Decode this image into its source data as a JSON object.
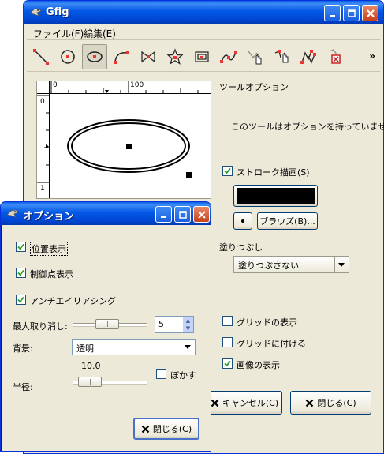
{
  "main_window": {
    "title": "Gfig",
    "menu": [
      "ファイル(F)",
      "編集(E)"
    ],
    "toolbar": {
      "tools": [
        "line-tool",
        "circle-tool",
        "ellipse-tool",
        "arc-tool",
        "polygon-tool",
        "star-tool",
        "spiral-tool",
        "bezier-tool",
        "move-object-tool",
        "move-point-tool",
        "copy-object-tool",
        "delete-object-tool"
      ],
      "selected": "ellipse-tool",
      "more": "»"
    },
    "ruler": {
      "top_labels": [
        "0",
        "100"
      ],
      "left_labels": [
        "0",
        "1"
      ]
    },
    "tool_options": {
      "heading": "ツールオプション",
      "message": "このツールはオプションを持っていません"
    },
    "stroke": {
      "label": "ストローク描画(S)",
      "checked": true,
      "color": "#000000",
      "brush_button": "ブラウズ(B)..."
    },
    "fill": {
      "label": "塗りつぶし",
      "value": "塗りつぶさない"
    },
    "grid": {
      "show_grid": "グリッドの表示",
      "snap_grid": "グリッドに付ける",
      "show_image": "画像の表示"
    },
    "buttons": {
      "cancel": "キャンセル(C)",
      "close": "閉じる(C)"
    }
  },
  "options_dialog": {
    "title": "オプション",
    "checkboxes": {
      "show_position": "位置表示",
      "show_control_points": "制御点表示",
      "antialiasing": "アンチエイリアシング"
    },
    "max_undo": {
      "label": "最大取り消し:",
      "value": "5"
    },
    "background": {
      "label": "背景:",
      "value": "透明"
    },
    "radius": {
      "label": "半径:",
      "value": "10.0",
      "blur_label": "ぼかす"
    },
    "close_button": "閉じる(C)"
  }
}
